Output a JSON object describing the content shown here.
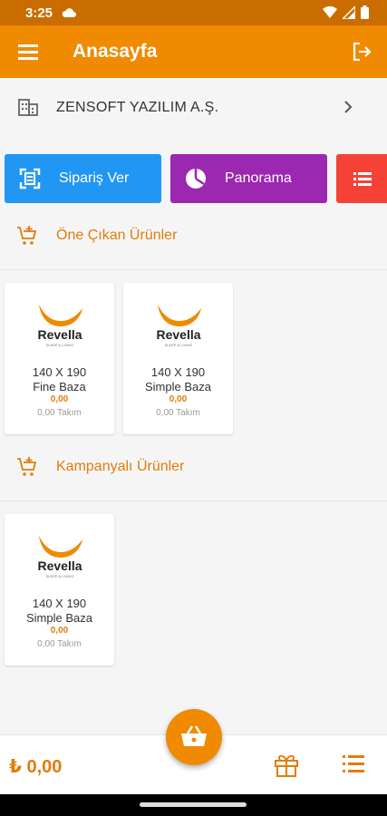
{
  "status_bar": {
    "time": "3:25"
  },
  "app_bar": {
    "title": "Anasayfa"
  },
  "company": {
    "name": "ZENSOFT YAZILIM A.Ş."
  },
  "actions": [
    {
      "label": "Sipariş Ver",
      "color": "#2196f3"
    },
    {
      "label": "Panorama",
      "color": "#9c27b0"
    },
    {
      "label": "",
      "color": "#f44336"
    }
  ],
  "sections": {
    "featured": {
      "title": "Öne Çıkan Ürünler"
    },
    "campaign": {
      "title": "Kampanyalı Ürünler"
    }
  },
  "featured_products": [
    {
      "brand": "Revella",
      "name_line1": "140 X 190",
      "name_line2": "Fine Baza",
      "price": "0,00",
      "unit": "0,00 Takım"
    },
    {
      "brand": "Revella",
      "name_line1": "140 X 190",
      "name_line2": "Simple Baza",
      "price": "0,00",
      "unit": "0,00 Takım"
    }
  ],
  "campaign_products": [
    {
      "brand": "Revella",
      "name_line1": "140 X 190",
      "name_line2": "Simple Baza",
      "price": "0,00",
      "unit": "0,00 Takım"
    }
  ],
  "bottom_bar": {
    "total": "₺ 0,00"
  },
  "colors": {
    "primary": "#f08a00",
    "status_bar": "#c96d00",
    "accent_text": "#e07d0a"
  }
}
